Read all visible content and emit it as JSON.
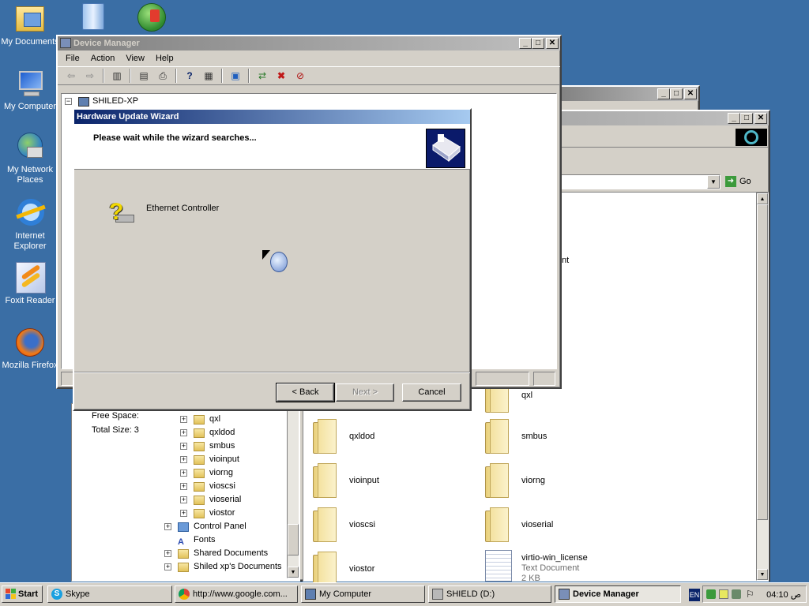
{
  "desktop": {
    "icons": [
      {
        "label": "My Documents"
      },
      {
        "label": "My Computer"
      },
      {
        "label": "My Network Places"
      },
      {
        "label": "Internet Explorer"
      },
      {
        "label": "Foxit Reader"
      },
      {
        "label": "Mozilla Firefox"
      }
    ]
  },
  "device_manager": {
    "title": "Device Manager",
    "menu": [
      "File",
      "Action",
      "View",
      "Help"
    ],
    "tree_root": "SHILED-XP"
  },
  "wizard": {
    "title": "Hardware Update Wizard",
    "header": "Please wait while the wizard searches...",
    "device_name": "Ethernet Controller",
    "back_label": "< Back",
    "next_label": "Next >",
    "cancel_label": "Cancel"
  },
  "explorer": {
    "address_go": "Go",
    "partial_text": "nt",
    "free_space_label": "Free Space:",
    "total_size_label": "Total Size: 3",
    "tree": [
      "qxl",
      "qxldod",
      "smbus",
      "vioinput",
      "viorng",
      "vioscsi",
      "vioserial",
      "viostor",
      "Control Panel",
      "Fonts",
      "Shared Documents",
      "Shiled xp's Documents"
    ],
    "files_left": [
      "qxldod",
      "vioinput",
      "vioscsi",
      "viostor"
    ],
    "files_right": [
      "qxl",
      "smbus",
      "viorng",
      "vioserial"
    ],
    "license": {
      "name": "virtio-win_license",
      "type": "Text Document",
      "size": "2 KB"
    }
  },
  "taskbar": {
    "start": "Start",
    "tasks": [
      "Skype",
      "http://www.google.com...",
      "My Computer",
      "SHIELD (D:)",
      "Device Manager"
    ],
    "lang": "EN",
    "clock": "04:10 ص"
  },
  "colors": {
    "desktop": "#3a6ea5",
    "title_active": "#0a246a",
    "face": "#d4d0c8"
  }
}
